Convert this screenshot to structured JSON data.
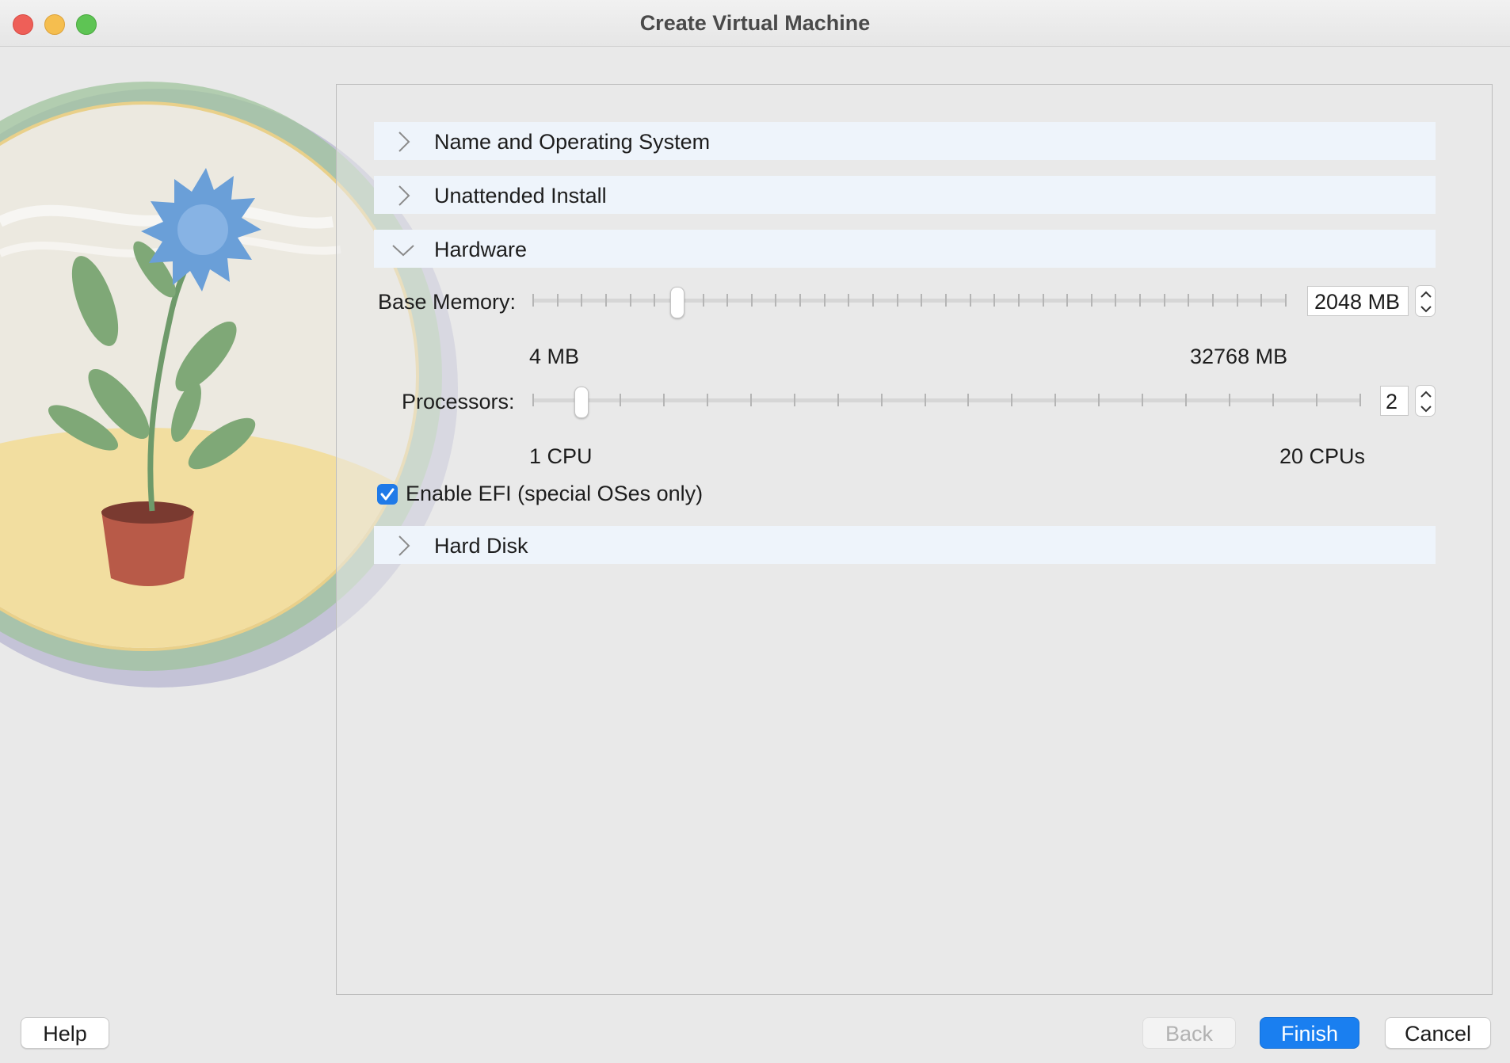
{
  "window": {
    "title": "Create Virtual Machine"
  },
  "sections": [
    {
      "label": "Name and Operating System",
      "expanded": false
    },
    {
      "label": "Unattended Install",
      "expanded": false
    },
    {
      "label": "Hardware",
      "expanded": true
    },
    {
      "label": "Hard Disk",
      "expanded": false
    }
  ],
  "hardware": {
    "memory": {
      "label": "Base Memory:",
      "value": "2048 MB",
      "min_label": "4 MB",
      "max_label": "32768 MB",
      "min": 4,
      "max": 32768,
      "current": 2048
    },
    "processors": {
      "label": "Processors:",
      "value": "2",
      "min_label": "1 CPU",
      "max_label": "20 CPUs",
      "min": 1,
      "max": 20,
      "current": 2
    },
    "efi": {
      "label": "Enable EFI (special OSes only)",
      "checked": true
    }
  },
  "buttons": {
    "help": "Help",
    "back": "Back",
    "finish": "Finish",
    "cancel": "Cancel"
  },
  "colors": {
    "accent": "#1a7ff0",
    "section_bg": "#eef4fb",
    "close": "#ee5f58",
    "minimize": "#f5be4f",
    "maximize": "#5ec454"
  }
}
